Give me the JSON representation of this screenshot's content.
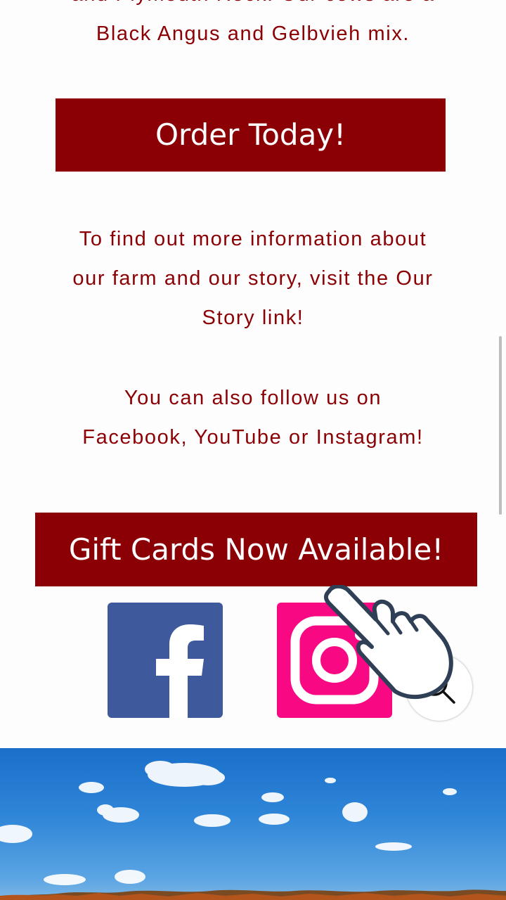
{
  "intro": {
    "line1": "and Plymouth Rock. Our cows are a",
    "line2": "Black Angus and Gelbvieh mix."
  },
  "order_button": {
    "label": "Order Today!"
  },
  "story": {
    "line1": "To find out more information about",
    "line2": "our farm and our story, visit the Our",
    "line3": "Story link!"
  },
  "follow": {
    "line1": "You can also follow us on",
    "line2": "Facebook, YouTube or Instagram!"
  },
  "gift_button": {
    "label": "Gift Cards Now Available!"
  },
  "social": [
    {
      "icon": "facebook-icon",
      "color": "#3f5a9c"
    },
    {
      "icon": "instagram-icon",
      "color": "#f90883"
    }
  ],
  "colors": {
    "accent": "#8b0004",
    "text_on_accent": "#ffffff"
  }
}
